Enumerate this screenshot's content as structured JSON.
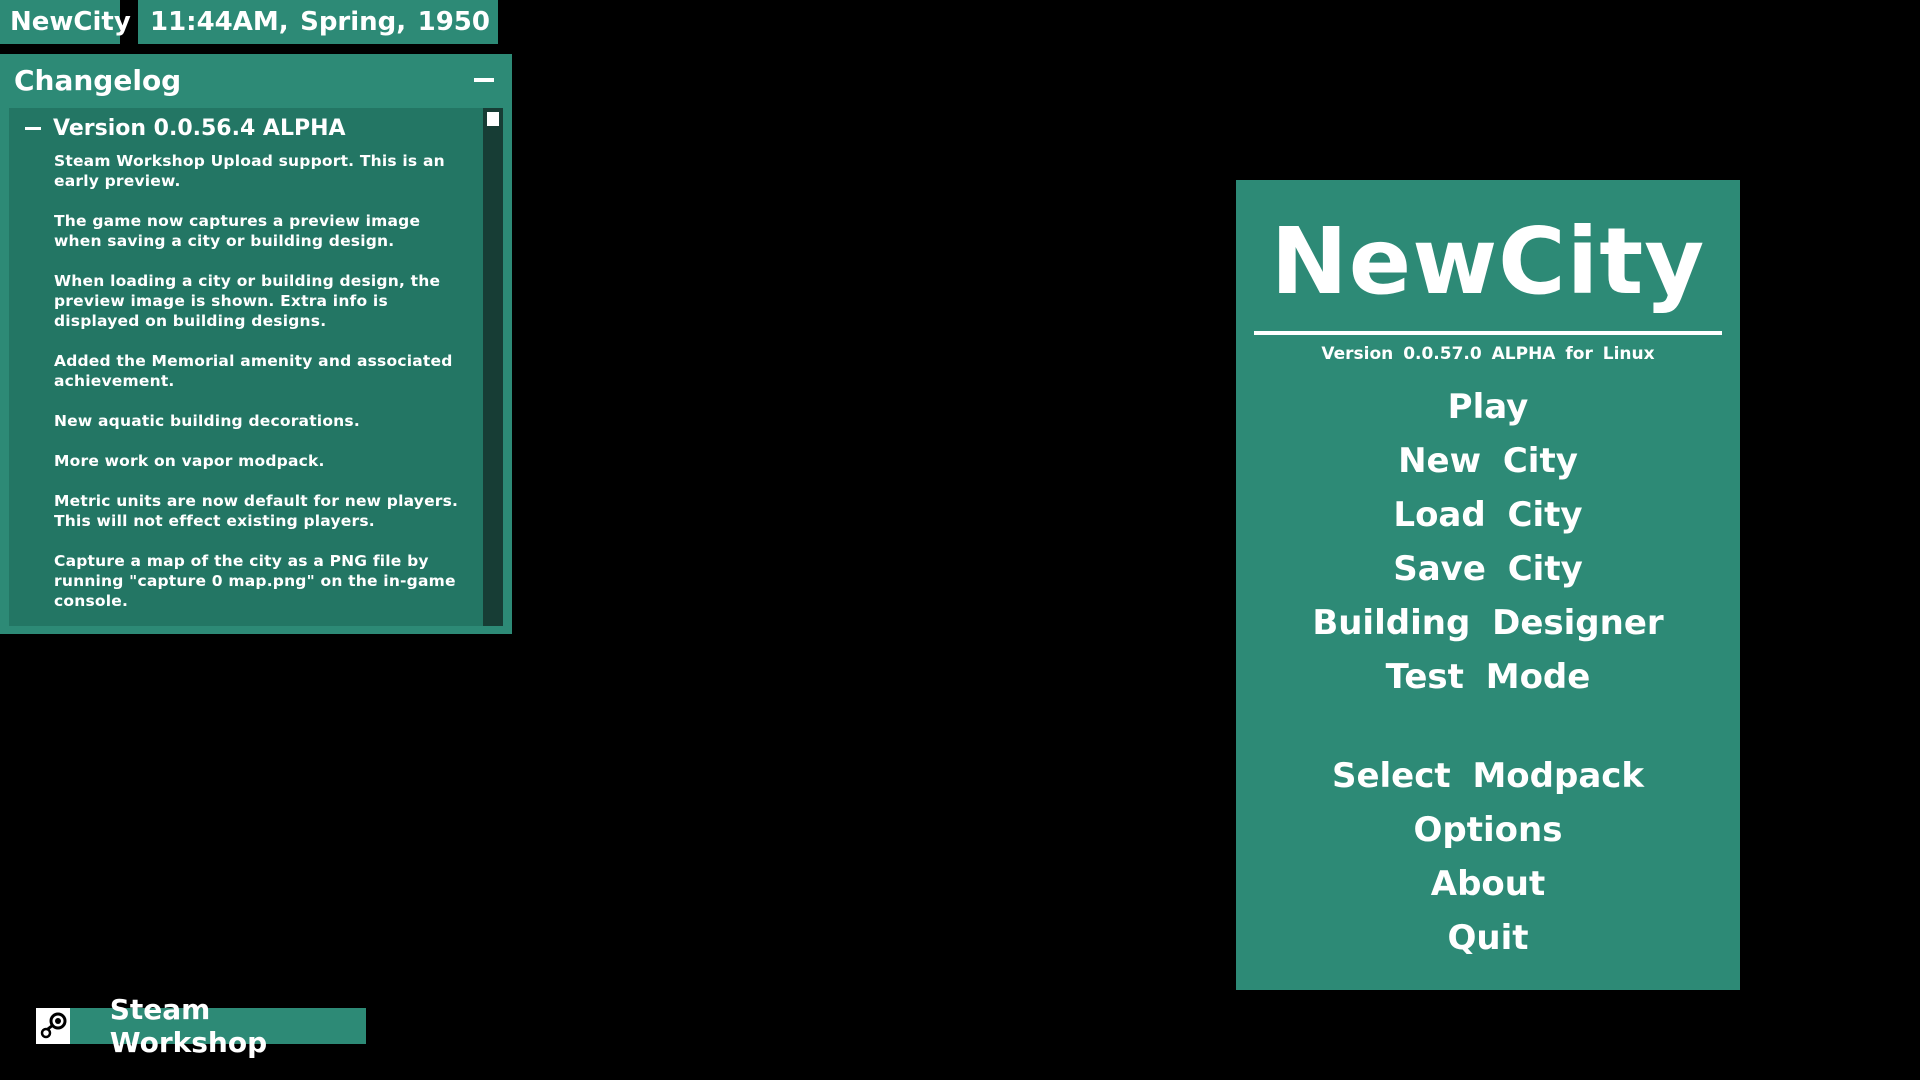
{
  "top_bar": {
    "app_name": "NewCity",
    "time": "11:44AM,",
    "season": "Spring,",
    "year": "1950"
  },
  "changelog": {
    "title": "Changelog",
    "version_label": "Version 0.0.56.4 ALPHA",
    "entries": [
      "Steam Workshop Upload support. This is an early preview.",
      "The game now captures a preview image when saving a city or building design.",
      "When loading a city or building design, the preview image is shown. Extra info is displayed on building designs.",
      "Added the Memorial amenity and associated achievement.",
      "New aquatic building decorations.",
      "More work on vapor modpack.",
      "Metric units are now default for new players. This will not effect existing players.",
      "Capture a map of the city as a PNG file by running \"capture 0 map.png\" on the in-game console."
    ]
  },
  "steam": {
    "label": "Steam Workshop",
    "icon": "steam-icon"
  },
  "menu": {
    "logo": "NewCity",
    "version": "Version 0.0.57.0 ALPHA for Linux",
    "items": [
      "Play",
      "New City",
      "Load City",
      "Save City",
      "Building Designer",
      "Test Mode",
      "Select Modpack",
      "Options",
      "About",
      "Quit"
    ]
  },
  "colors": {
    "panel": "#2d8a76",
    "panel_inner": "#237664",
    "background": "#000000",
    "text": "#ffffff"
  }
}
